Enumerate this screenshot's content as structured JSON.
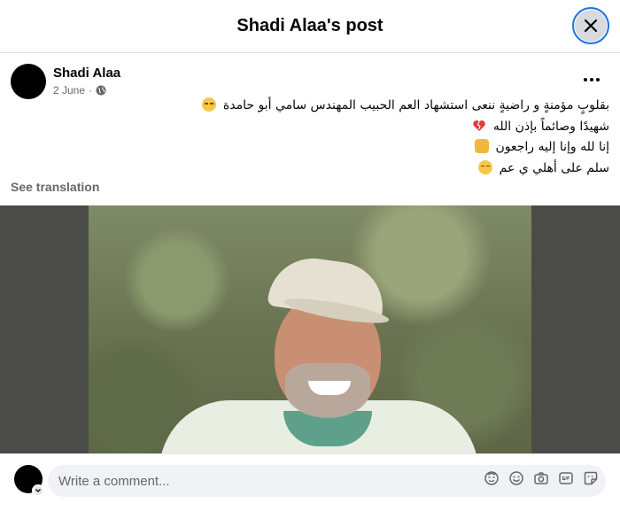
{
  "header": {
    "title": "Shadi Alaa's post"
  },
  "post": {
    "author": "Shadi Alaa",
    "date": "2 June",
    "date_separator": "·",
    "lines": [
      {
        "text": "بقلوبٍ مؤمنةٍ و راضيةٍ ننعى استشهاد العم الحبيب المهندس سامي أبو حامدة",
        "emoji": "pensive-face-emoji"
      },
      {
        "text": "شهيدًا وصائماً بإذن الله",
        "emoji": "broken-heart-emoji"
      },
      {
        "text": "إنا لله وإنا إليه راجعون",
        "emoji": "palms-up-together-emoji"
      },
      {
        "text": "سلم على أهلي ي عم",
        "emoji": "pensive-face-emoji"
      }
    ],
    "see_translation": "See translation"
  },
  "comment": {
    "placeholder": "Write a comment..."
  },
  "icons": {
    "close": "close-icon",
    "globe": "globe-icon",
    "more": "more-options-icon",
    "avatar_sticker": "avatar-sticker-icon",
    "emoji": "emoji-icon",
    "camera": "camera-icon",
    "gif": "gif-icon",
    "sticker": "sticker-icon"
  },
  "colors": {
    "accent": "#1b74e4",
    "secondary_text": "#65676b"
  }
}
